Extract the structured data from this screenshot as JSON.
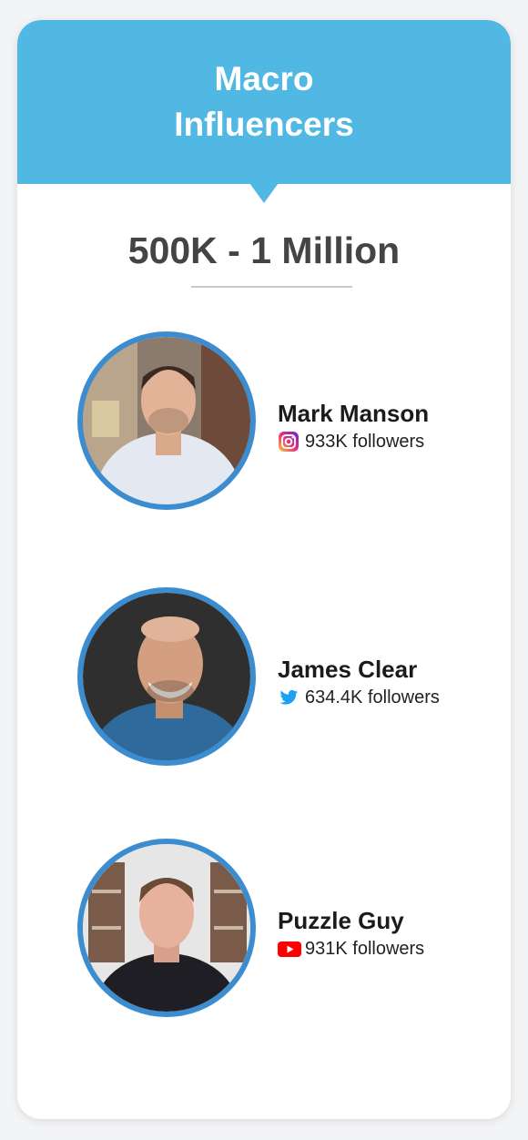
{
  "card": {
    "title_line1": "Macro",
    "title_line2": "Influencers",
    "range": "500K - 1 Million",
    "accent_color": "#51b8e4",
    "ring_color": "#3c8dd0"
  },
  "influencers": [
    {
      "name": "Mark Manson",
      "platform_icon": "instagram-icon",
      "followers": "933K followers"
    },
    {
      "name": "James Clear",
      "platform_icon": "twitter-icon",
      "followers": "634.4K followers"
    },
    {
      "name": "Puzzle Guy",
      "platform_icon": "youtube-icon",
      "followers": "931K followers"
    }
  ]
}
